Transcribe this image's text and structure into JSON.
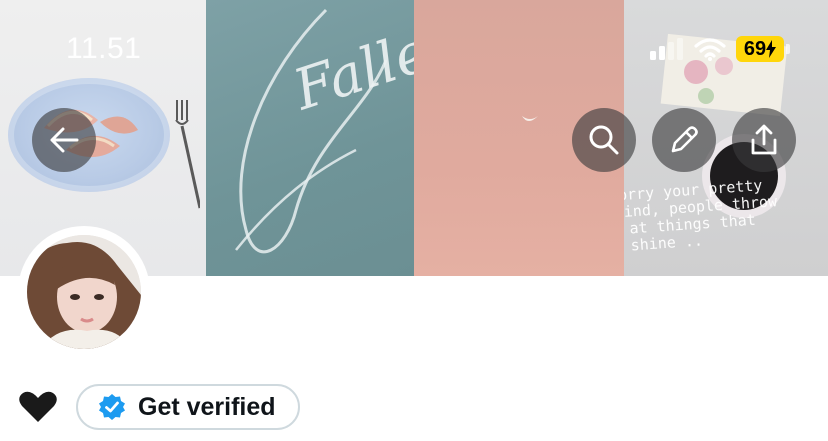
{
  "status_bar": {
    "time": "11.51",
    "battery_percent": "69",
    "charging": true,
    "wifi_bars": 3,
    "cell_bars": 2
  },
  "header_banner": {
    "script_text": "Fallen",
    "quote_text": "dont worry your pretty little mind, people throw rocks at things that shine .."
  },
  "toolbar": {
    "back_icon": "arrow-left-icon",
    "search_icon": "search-icon",
    "edit_icon": "pencil-icon",
    "share_icon": "share-icon"
  },
  "profile": {
    "emoji": "❤",
    "verify_label": "Get verified"
  },
  "colors": {
    "verified_blue": "#1d9bf0",
    "battery_yellow": "#ffd60a",
    "button_overlay": "#3a3a3c"
  }
}
